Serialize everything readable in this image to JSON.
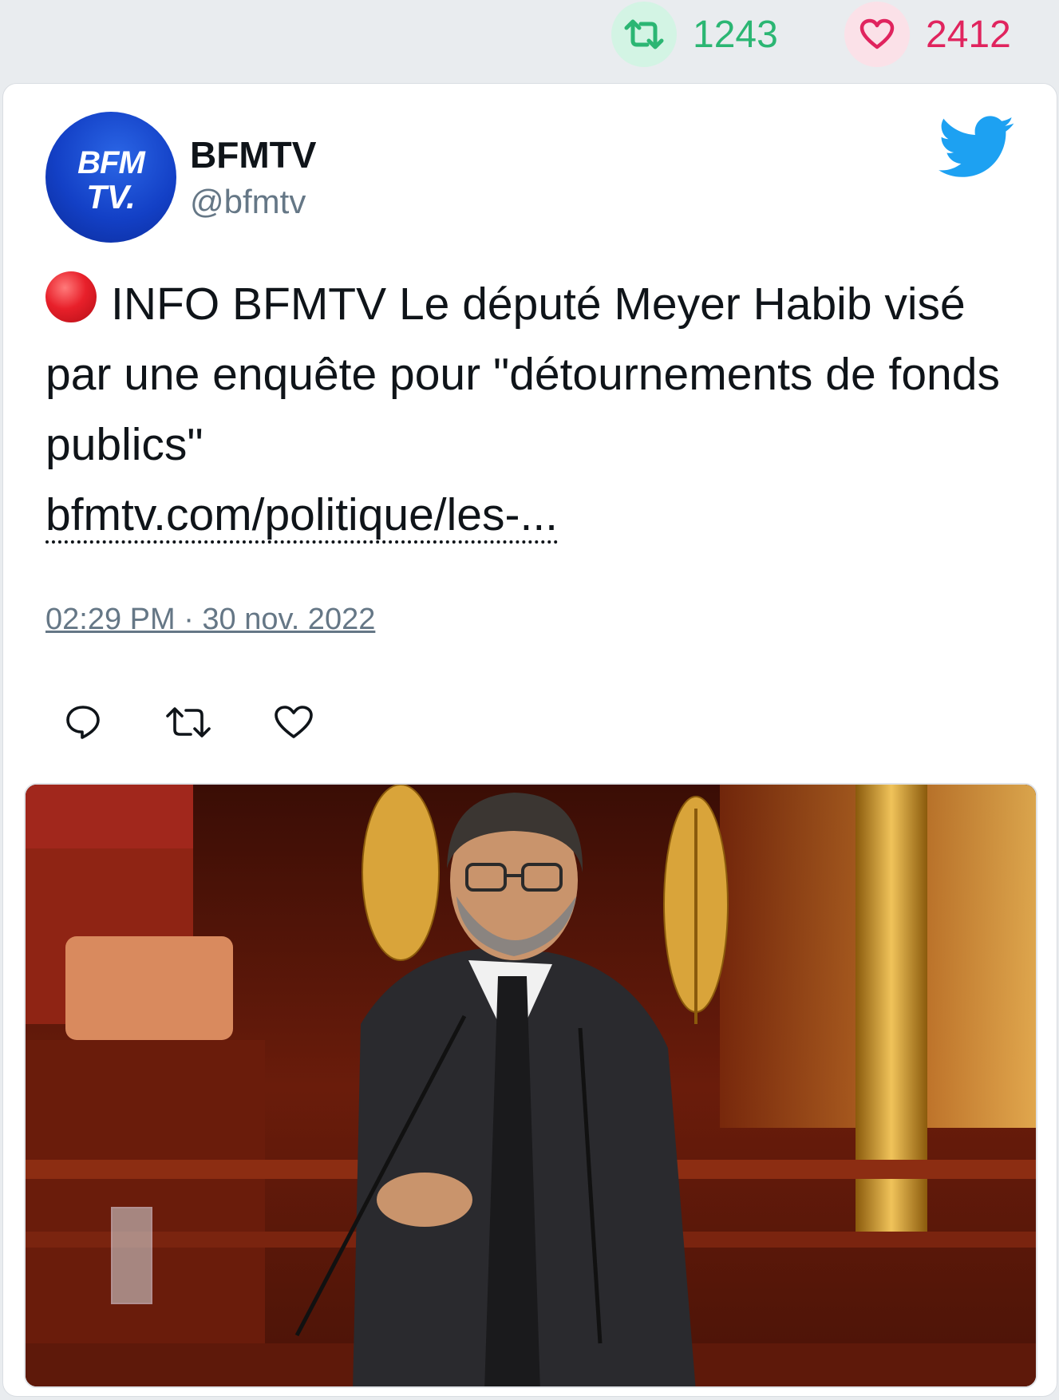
{
  "stats": {
    "retweets": "1243",
    "likes": "2412",
    "retweet_color": "#2bb673",
    "like_color": "#e0245e"
  },
  "author": {
    "name": "BFMTV",
    "handle": "@bfmtv",
    "avatar_text_line1": "BFM",
    "avatar_text_line2": "TV."
  },
  "tweet": {
    "text": "INFO BFMTV Le député Meyer Habib visé par une enquête pour \"détournements de fonds publics\"",
    "link": "bfmtv.com/politique/les-...",
    "timestamp": "02:29 PM · 30 nov. 2022"
  },
  "icons": {
    "retweet": "retweet-icon",
    "like": "heart-icon",
    "reply": "reply-icon",
    "brand": "twitter-bird-icon",
    "breaking": "red-circle-icon"
  },
  "colors": {
    "twitter_blue": "#1da1f2",
    "text": "#0f1419",
    "muted": "#657786"
  }
}
